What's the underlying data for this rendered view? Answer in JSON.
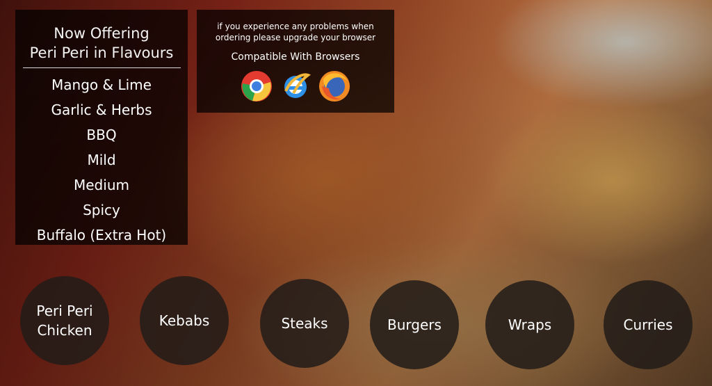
{
  "flavours_panel": {
    "title": "Now Offering\nPeri Peri in Flavours",
    "items": [
      "Mango & Lime",
      "Garlic & Herbs",
      "BBQ",
      "Mild",
      "Medium",
      "Spicy",
      "Buffalo (Extra Hot)"
    ]
  },
  "browser_panel": {
    "notice": "if you experience any problems when\nordering please upgrade your browser",
    "compatible_label": "Compatible With Browsers",
    "browsers": [
      {
        "icon": "chrome-icon"
      },
      {
        "icon": "internet-explorer-icon"
      },
      {
        "icon": "firefox-icon"
      }
    ]
  },
  "nav": {
    "items": [
      {
        "label": "Peri Peri\nChicken"
      },
      {
        "label": "Kebabs"
      },
      {
        "label": "Steaks"
      },
      {
        "label": "Burgers"
      },
      {
        "label": "Wraps"
      },
      {
        "label": "Curries"
      }
    ]
  }
}
